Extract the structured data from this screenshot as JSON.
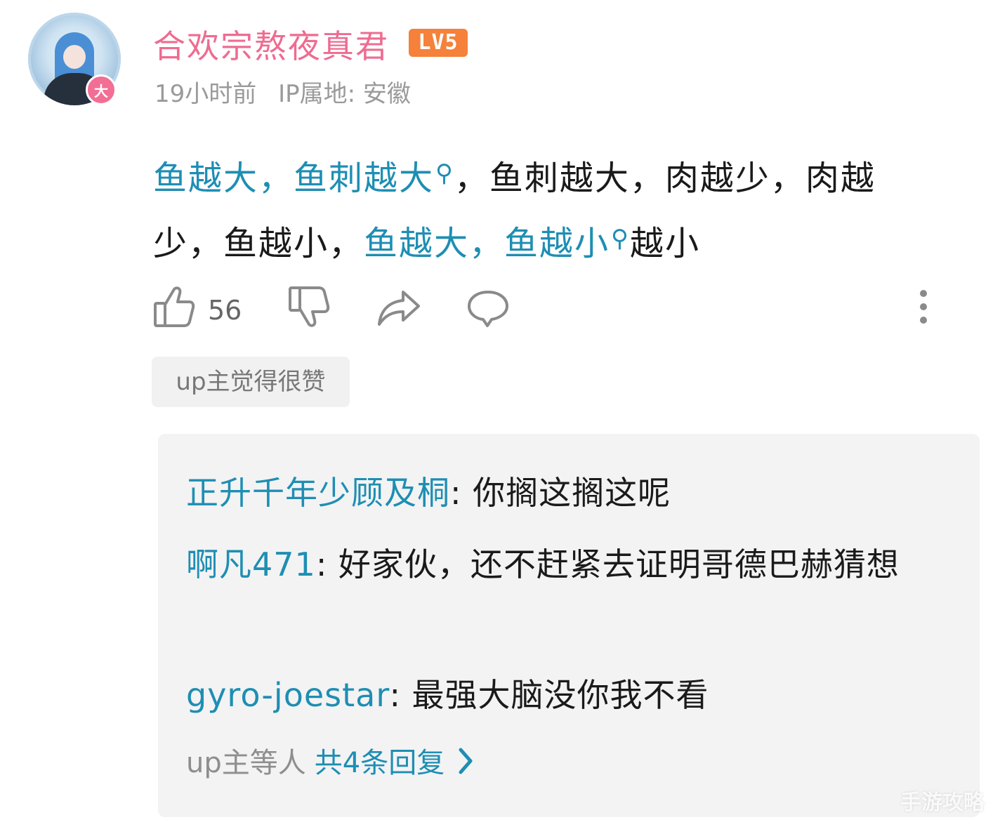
{
  "comment": {
    "username": "合欢宗熬夜真君",
    "level_badge": "LV5",
    "avatar_badge": "大",
    "time": "19小时前",
    "ip_location": "IP属地: 安徽",
    "text_segments": [
      {
        "text": "鱼越大，鱼刺越大",
        "link": true,
        "search_icon": true
      },
      {
        "text": "，鱼刺越大，肉越少，肉越少，鱼越小，",
        "link": false
      },
      {
        "text": "鱼越大，鱼越小",
        "link": true,
        "search_icon": true
      },
      {
        "text": "越小",
        "link": false
      }
    ],
    "search_icon_name": "search-icon",
    "like_count": "56",
    "up_tag": "up主觉得很赞"
  },
  "replies": [
    {
      "name": "正升千年少顾及桐",
      "text": ": 你搁这搁这呢"
    },
    {
      "name": "啊凡471",
      "text": ": 好家伙，还不赶紧去证明哥德巴赫猜想"
    },
    {
      "name": "gyro-joestar",
      "text": ": 最强大脑没你我不看"
    }
  ],
  "reply_footer": {
    "prefix": "up主等人",
    "count_label": "共4条回复"
  },
  "colors": {
    "username": "#ee6c91",
    "link": "#1e8eb3",
    "level": "#f5813a",
    "reply_bg": "#f3f3f4"
  },
  "watermark": "手游攻略"
}
